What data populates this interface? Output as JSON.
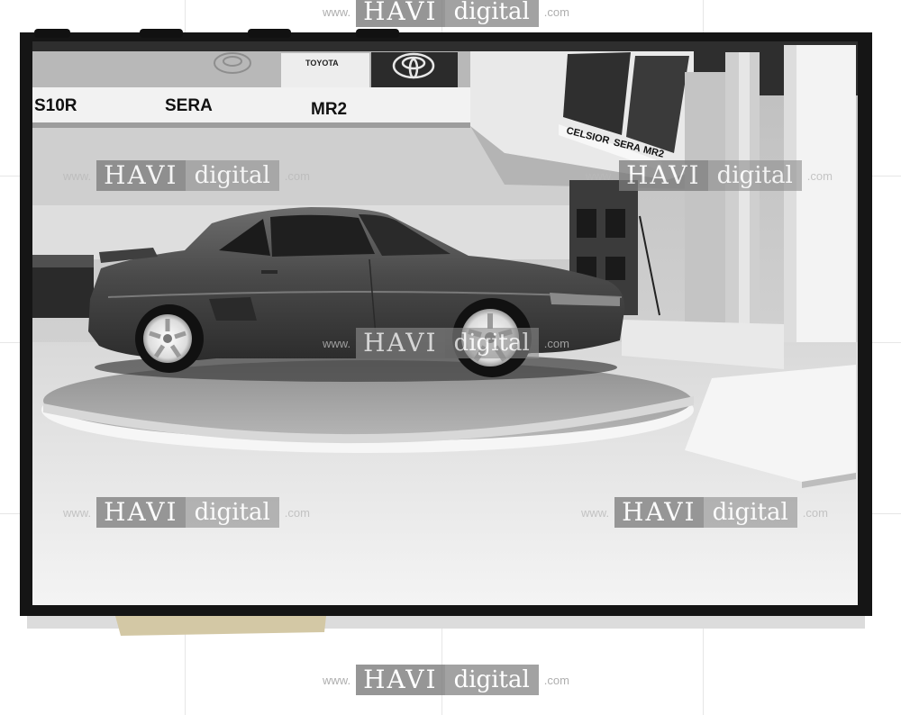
{
  "signage": {
    "brand": "TOYOTA",
    "models": [
      "S10R",
      "SERA",
      "MR2"
    ],
    "side_panel": [
      "CELSIOR",
      "SERA",
      "MR2"
    ]
  },
  "watermark": {
    "prefix": "www.",
    "brand": "HAVI",
    "word": "digital",
    "suffix": ".com"
  }
}
